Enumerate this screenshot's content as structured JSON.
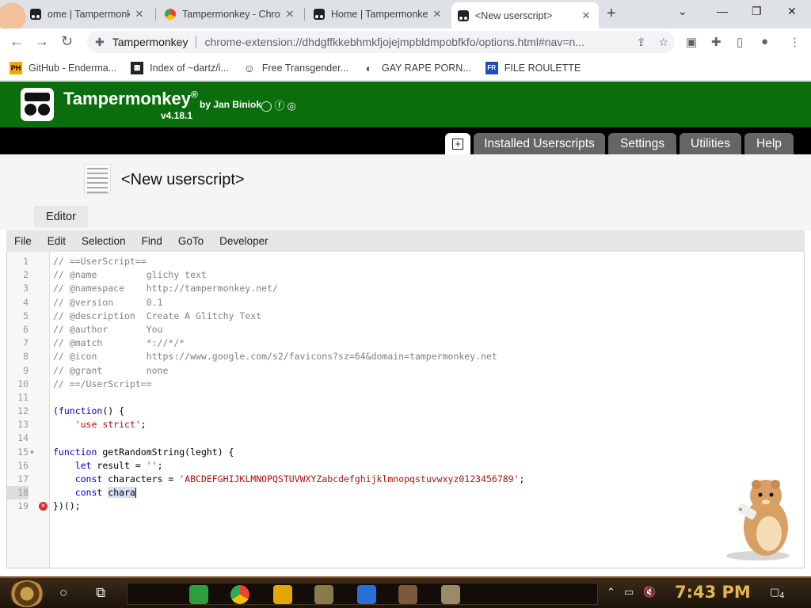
{
  "browser": {
    "tabs": [
      {
        "title": "ome | Tampermonke",
        "icon": "tampermonkey-icon",
        "active": false
      },
      {
        "title": "Tampermonkey - Chro",
        "icon": "chrome-icon",
        "active": false
      },
      {
        "title": "Home | Tampermonke",
        "icon": "tampermonkey-icon",
        "active": false
      },
      {
        "title": "<New userscript>",
        "icon": "tampermonkey-icon",
        "active": true
      }
    ],
    "new_tab_label": "+",
    "window_controls": [
      "⌄",
      "—",
      "❐",
      "✕"
    ],
    "site_name": "Tampermonkey",
    "url": "chrome-extension://dhdgffkkebhmkfjojejmpbldmpobfkfo/options.html#nav=n...",
    "bookmarks": [
      {
        "label": "GitHub - Enderma...",
        "icon": "PH",
        "color": "#f7a500"
      },
      {
        "label": "Index of ~dartz/i...",
        "icon": "▦",
        "color": "#222222"
      },
      {
        "label": "Free Transgender...",
        "icon": "☺",
        "color": "#333333"
      },
      {
        "label": "GAY RAPE PORN...",
        "icon": "◐",
        "color": "#555555"
      },
      {
        "label": "FILE ROULETTE",
        "icon": "FR",
        "color": "#1e4fb5"
      }
    ]
  },
  "tampermonkey": {
    "brand": "Tampermonkey",
    "registered": "®",
    "by": "by Jan Biniok",
    "version": "v4.18.1",
    "social_icons": "◯ⓕ◎",
    "nav": [
      {
        "label": "+",
        "kind": "new-script"
      },
      {
        "label": "Installed Userscripts"
      },
      {
        "label": "Settings"
      },
      {
        "label": "Utilities"
      },
      {
        "label": "Help"
      }
    ],
    "script_title": "<New userscript>",
    "editor_tab": "Editor",
    "menu": [
      "File",
      "Edit",
      "Selection",
      "Find",
      "GoTo",
      "Developer"
    ]
  },
  "code": {
    "current_line": 18,
    "error_line": 19,
    "lines": [
      "// ==UserScript==",
      "// @name         glichy text",
      "// @namespace    http://tampermonkey.net/",
      "// @version      0.1",
      "// @description  Create A Glitchy Text",
      "// @author       You",
      "// @match        *://*/*",
      "// @icon         https://www.google.com/s2/favicons?sz=64&domain=tampermonkey.net",
      "// @grant        none",
      "// ==/UserScript==",
      "",
      "(function() {",
      "    'use strict';",
      "",
      "function getRandomString(leght) {",
      "    let result = '';",
      "    const characters = 'ABCDEFGHIJKLMNOPQSTUVWXYZabcdefghijklmnopqstuvwxyz0123456789';",
      "    const chara",
      "})();"
    ]
  },
  "taskbar": {
    "clock": "7:43 PM",
    "notification_count": "4"
  },
  "colors": {
    "tm_green": "#0a6e0c",
    "tm_tab_gray": "#656565",
    "comment": "#808080",
    "keyword": "#0000cc",
    "string": "#a11111",
    "error": "#d32f2f",
    "clock": "#e2b650"
  }
}
